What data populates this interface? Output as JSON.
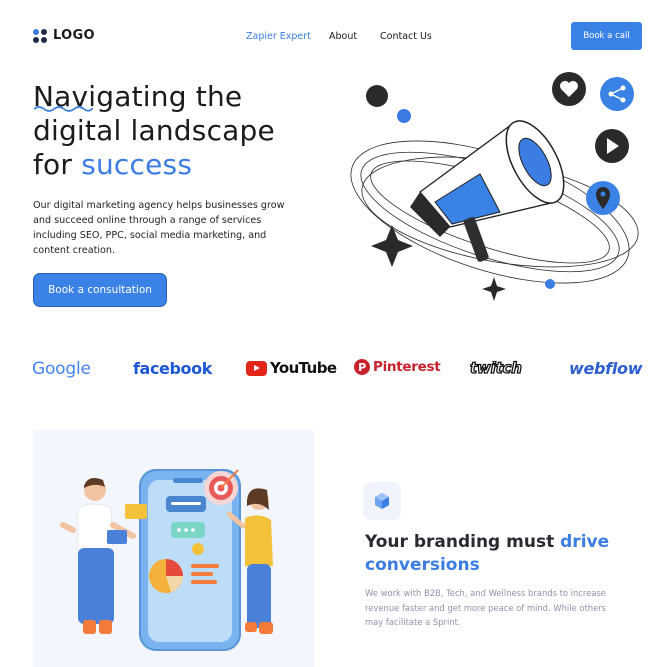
{
  "nav": {
    "logo": "LOGO",
    "links": [
      "Zapier Expert",
      "About",
      "Contact Us"
    ],
    "cta": "Book a call"
  },
  "hero": {
    "title_line1": "Navigating the",
    "title_line2": "digital landscape",
    "title_line3_prefix": "for ",
    "title_line3_accent": "success",
    "description": "Our digital marketing agency helps businesses grow and succeed online through a range of services including SEO, PPC, social media marketing, and content creation.",
    "cta": "Book a consultation"
  },
  "brands": [
    "Google",
    "facebook",
    "YouTube",
    "Pinterest",
    "twitch",
    "webflow"
  ],
  "section": {
    "title_prefix": "Your branding must ",
    "title_accent1": "drive",
    "title_accent2": "conversions",
    "description": "We work with B2B, Tech, and Wellness brands to increase revenue faster and get more peace of mind. While others may facilitate a Sprint."
  },
  "colors": {
    "accent": "#3b82e6",
    "dark": "#1f2430",
    "muted": "#8e93aa"
  },
  "icons": [
    "logo-dots-icon",
    "megaphone-illustration",
    "heart-icon",
    "share-icon",
    "play-icon",
    "location-pin-icon",
    "sparkle-icon",
    "cube-icon"
  ]
}
